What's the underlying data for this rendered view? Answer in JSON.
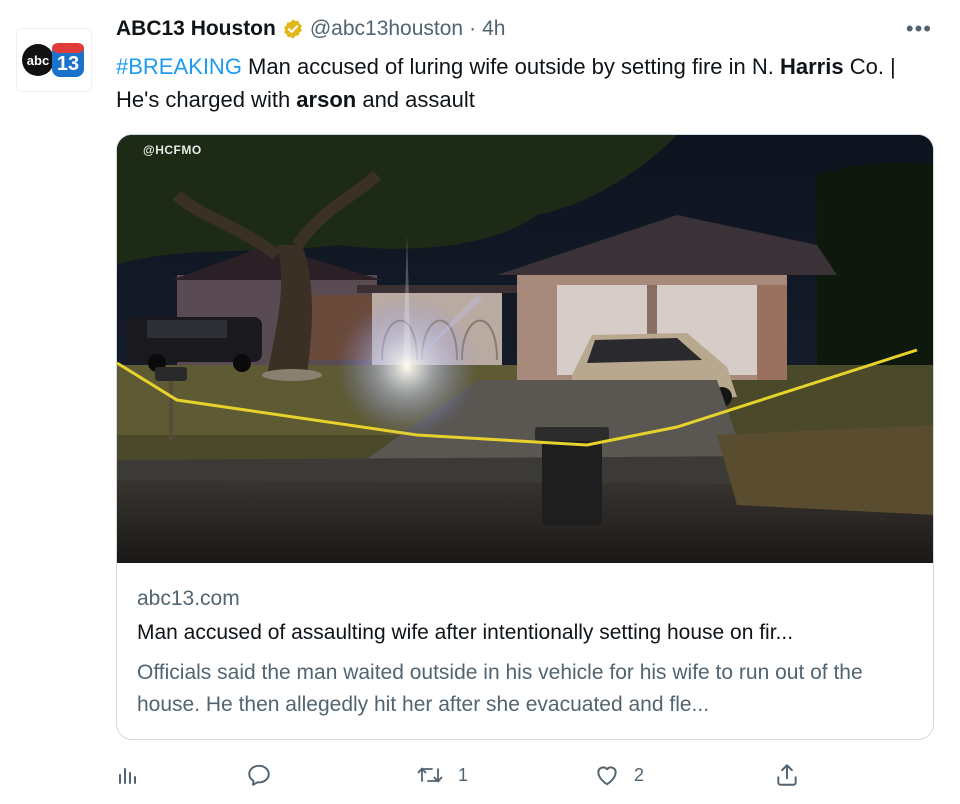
{
  "tweet": {
    "author_name": "ABC13 Houston",
    "handle": "@abc13houston",
    "separator": "·",
    "time": "4h",
    "more_label": "•••",
    "text": {
      "hashtag": "#BREAKING",
      "part1": " Man accused of luring wife outside by setting fire in N. ",
      "bold1": "Harris",
      "part2": " Co. | He's charged with ",
      "bold2": "arson",
      "part3": " and assault"
    }
  },
  "avatar": {
    "logo_text": "abc",
    "logo_number": "13"
  },
  "card": {
    "image_watermark": "@HCFMO",
    "domain": "abc13.com",
    "title": "Man accused of assaulting wife after intentionally setting house on fir...",
    "description": "Officials said the man waited outside in his vehicle for his wife to run out of the house. He then allegedly hit her after she evacuated and fle..."
  },
  "actions": {
    "analytics_icon": "analytics-icon",
    "reply_icon": "reply-icon",
    "retweet_icon": "retweet-icon",
    "retweet_count": "1",
    "like_icon": "heart-icon",
    "like_count": "2",
    "share_icon": "share-icon"
  },
  "colors": {
    "link": "#1d9bf0",
    "secondary_text": "#536471",
    "border": "#cfd9de",
    "verified_gold": "#e2b719",
    "logo_blue": "#1a73c8"
  }
}
